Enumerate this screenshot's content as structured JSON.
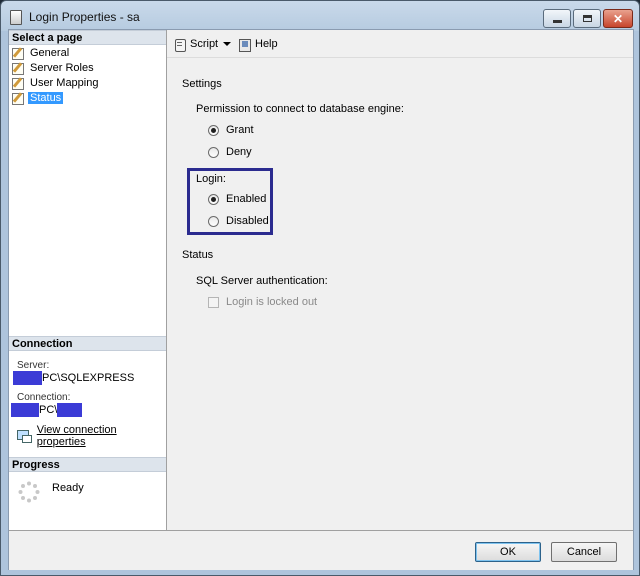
{
  "window": {
    "title": "Login Properties - sa"
  },
  "left": {
    "select_page_header": "Select a page",
    "pages": [
      {
        "label": "General"
      },
      {
        "label": "Server Roles"
      },
      {
        "label": "User Mapping"
      },
      {
        "label": "Status"
      }
    ],
    "selected_page": "Status",
    "connection": {
      "header": "Connection",
      "server_label": "Server:",
      "server_value": "PC\\SQLEXPRESS",
      "connection_label": "Connection:",
      "connection_value": "PC\\",
      "view_props_link": "View connection properties"
    },
    "progress": {
      "header": "Progress",
      "status": "Ready"
    }
  },
  "toolbar": {
    "script_label": "Script",
    "help_label": "Help"
  },
  "settings": {
    "heading": "Settings",
    "permission_label": "Permission to connect to database engine:",
    "permission_options": [
      {
        "label": "Grant",
        "checked": true
      },
      {
        "label": "Deny",
        "checked": false
      }
    ],
    "login_label": "Login:",
    "login_options": [
      {
        "label": "Enabled",
        "checked": true
      },
      {
        "label": "Disabled",
        "checked": false
      }
    ],
    "highlight_color": "#2b2b8f"
  },
  "status": {
    "heading": "Status",
    "auth_label": "SQL Server authentication:",
    "locked_out_label": "Login is locked out",
    "locked_out_checked": false
  },
  "buttons": {
    "ok": "OK",
    "cancel": "Cancel"
  },
  "colors": {
    "redaction": "#3b3bd6",
    "selection": "#3399ff"
  }
}
